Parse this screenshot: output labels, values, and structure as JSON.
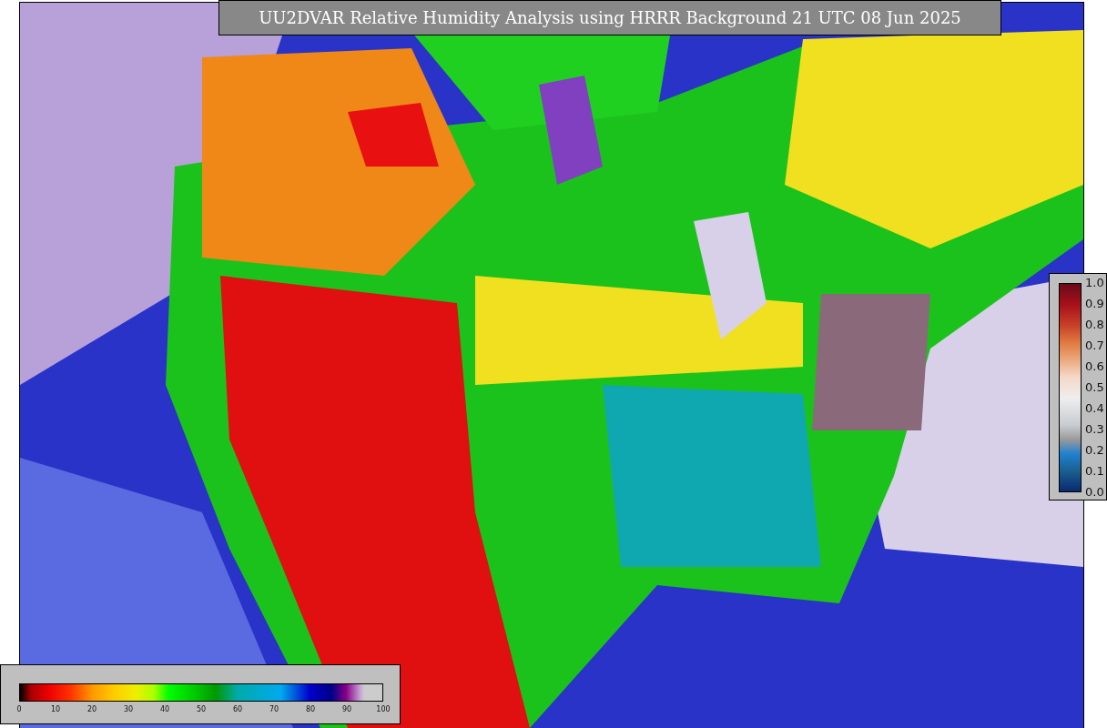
{
  "title": "UU2DVAR Relative Humidity Analysis using HRRR Background 21 UTC 08 Jun 2025",
  "ob_legend": {
    "ticks": [
      "1.0",
      "0.9",
      "0.8",
      "0.7",
      "0.6",
      "0.5",
      "0.4",
      "0.3",
      "0.2",
      "0.1",
      "0.0"
    ]
  },
  "humidity_legend": {
    "ticks": [
      "0",
      "10",
      "20",
      "30",
      "40",
      "50",
      "60",
      "70",
      "80",
      "90",
      "100"
    ]
  }
}
